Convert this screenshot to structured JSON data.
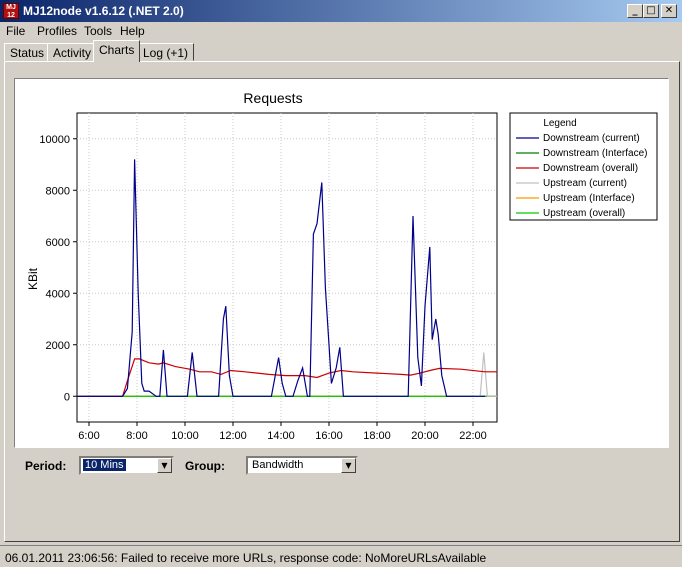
{
  "window": {
    "title": "MJ12node v1.6.12 (.NET 2.0)",
    "icon_text": "MJ 12",
    "controls": {
      "minimize": "_",
      "maximize": "□",
      "close": "✕"
    }
  },
  "menu": [
    "File",
    "Profiles",
    "Tools",
    "Help"
  ],
  "tabs": [
    {
      "label": "Status",
      "active": false
    },
    {
      "label": "Activity",
      "active": false
    },
    {
      "label": "Charts",
      "active": true
    },
    {
      "label": "Log (+1)",
      "active": false
    }
  ],
  "controls": {
    "period_label": "Period:",
    "period_value": "10 Mins",
    "group_label": "Group:",
    "group_value": "Bandwidth",
    "dropdown_icon": "chevron-down-icon"
  },
  "status": {
    "text": "06.01.2011 23:06:56: Failed to receive more URLs, response code: NoMoreURLsAvailable"
  },
  "chart_data": {
    "type": "line",
    "title": "Requests",
    "ylabel": "KBit",
    "xlabel": "",
    "xlim": [
      5.5,
      23.0
    ],
    "ylim": [
      -1000,
      11000
    ],
    "xticks": [
      6,
      8,
      10,
      12,
      14,
      16,
      18,
      20,
      22
    ],
    "xtick_labels": [
      "6:00",
      "8:00",
      "10:00",
      "12:00",
      "14:00",
      "16:00",
      "18:00",
      "20:00",
      "22:00"
    ],
    "yticks": [
      0,
      2000,
      4000,
      6000,
      8000,
      10000
    ],
    "ytick_labels": [
      "0",
      "2000",
      "4000",
      "6000",
      "8000",
      "10000"
    ],
    "grid": true,
    "legend_title": "Legend",
    "legend_position": "right",
    "series": [
      {
        "name": "Downstream (current)",
        "color": "#00008b",
        "points": [
          [
            5.5,
            0
          ],
          [
            7.4,
            0
          ],
          [
            7.6,
            300
          ],
          [
            7.8,
            2500
          ],
          [
            7.9,
            9200
          ],
          [
            8.05,
            4000
          ],
          [
            8.2,
            500
          ],
          [
            8.3,
            200
          ],
          [
            8.5,
            200
          ],
          [
            8.8,
            0
          ],
          [
            8.95,
            0
          ],
          [
            9.1,
            1800
          ],
          [
            9.25,
            0
          ],
          [
            10.1,
            0
          ],
          [
            10.3,
            1700
          ],
          [
            10.5,
            0
          ],
          [
            11.4,
            0
          ],
          [
            11.6,
            3000
          ],
          [
            11.7,
            3500
          ],
          [
            11.85,
            800
          ],
          [
            12.0,
            0
          ],
          [
            13.6,
            0
          ],
          [
            13.9,
            1500
          ],
          [
            14.05,
            500
          ],
          [
            14.2,
            0
          ],
          [
            14.5,
            0
          ],
          [
            14.7,
            600
          ],
          [
            14.9,
            1100
          ],
          [
            15.1,
            0
          ],
          [
            15.2,
            0
          ],
          [
            15.35,
            6300
          ],
          [
            15.5,
            6700
          ],
          [
            15.7,
            8300
          ],
          [
            15.85,
            4200
          ],
          [
            16.0,
            2000
          ],
          [
            16.1,
            500
          ],
          [
            16.3,
            1100
          ],
          [
            16.45,
            1900
          ],
          [
            16.6,
            0
          ],
          [
            16.7,
            0
          ],
          [
            19.1,
            0
          ],
          [
            19.3,
            0
          ],
          [
            19.5,
            7000
          ],
          [
            19.7,
            1500
          ],
          [
            19.85,
            400
          ],
          [
            20.0,
            3500
          ],
          [
            20.2,
            5800
          ],
          [
            20.3,
            2200
          ],
          [
            20.45,
            3000
          ],
          [
            20.55,
            2400
          ],
          [
            20.7,
            800
          ],
          [
            20.9,
            0
          ],
          [
            22.5,
            0
          ]
        ]
      },
      {
        "name": "Downstream (Interface)",
        "color": "#008000",
        "points": [
          [
            5.5,
            0
          ],
          [
            23.0,
            0
          ]
        ]
      },
      {
        "name": "Downstream (overall)",
        "color": "#cc0000",
        "points": [
          [
            5.5,
            0
          ],
          [
            7.4,
            0
          ],
          [
            7.6,
            600
          ],
          [
            7.9,
            1450
          ],
          [
            8.1,
            1450
          ],
          [
            8.5,
            1300
          ],
          [
            8.9,
            1250
          ],
          [
            9.1,
            1300
          ],
          [
            9.6,
            1150
          ],
          [
            10.2,
            1050
          ],
          [
            10.6,
            950
          ],
          [
            11.1,
            950
          ],
          [
            11.5,
            850
          ],
          [
            11.9,
            1000
          ],
          [
            12.5,
            950
          ],
          [
            13.5,
            850
          ],
          [
            14.2,
            800
          ],
          [
            15.0,
            800
          ],
          [
            15.5,
            730
          ],
          [
            16.0,
            900
          ],
          [
            16.5,
            1000
          ],
          [
            17.0,
            950
          ],
          [
            18.0,
            900
          ],
          [
            19.0,
            850
          ],
          [
            19.4,
            820
          ],
          [
            19.8,
            900
          ],
          [
            20.2,
            1000
          ],
          [
            20.6,
            1080
          ],
          [
            21.5,
            1050
          ],
          [
            22.5,
            950
          ],
          [
            23.0,
            950
          ]
        ]
      },
      {
        "name": "Upstream (current)",
        "color": "#c0c0c0",
        "points": [
          [
            22.0,
            0
          ],
          [
            22.3,
            0
          ],
          [
            22.45,
            1700
          ],
          [
            22.6,
            0
          ],
          [
            23.0,
            0
          ]
        ]
      },
      {
        "name": "Upstream (Interface)",
        "color": "#ff9900",
        "points": [
          [
            5.5,
            0
          ],
          [
            23.0,
            0
          ]
        ]
      },
      {
        "name": "Upstream (overall)",
        "color": "#00cc00",
        "points": [
          [
            5.5,
            0
          ],
          [
            23.0,
            0
          ]
        ]
      }
    ]
  }
}
